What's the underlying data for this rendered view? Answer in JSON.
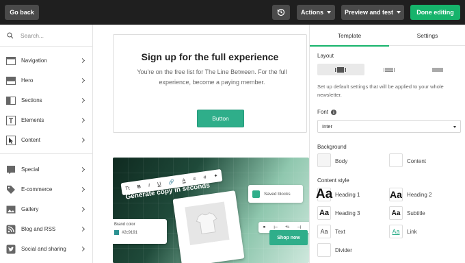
{
  "topbar": {
    "go_back": "Go back",
    "actions": "Actions",
    "preview": "Preview and test",
    "done": "Done editing",
    "history_icon": "history-icon"
  },
  "sidebar": {
    "search_placeholder": "Search...",
    "items": [
      {
        "label": "Navigation",
        "icon": "navigation-icon"
      },
      {
        "label": "Hero",
        "icon": "hero-icon"
      },
      {
        "label": "Sections",
        "icon": "sections-icon"
      },
      {
        "label": "Elements",
        "icon": "elements-icon"
      },
      {
        "label": "Content",
        "icon": "cursor-icon"
      },
      {
        "label": "Special",
        "icon": "special-icon"
      },
      {
        "label": "E-commerce",
        "icon": "tag-icon"
      },
      {
        "label": "Gallery",
        "icon": "image-icon"
      },
      {
        "label": "Blog and RSS",
        "icon": "rss-icon"
      },
      {
        "label": "Social and sharing",
        "icon": "twitter-icon"
      }
    ]
  },
  "canvas": {
    "card_title": "Sign up for the full experience",
    "card_body": "You're on the free list for The Line Between. For the full experience, become a paying member.",
    "card_button": "Button",
    "promo": {
      "toolbar": [
        "Tt",
        "B",
        "I",
        "U",
        "🔗",
        "A",
        "≡",
        "#",
        "✦"
      ],
      "headline": "Generate copy in seconds",
      "saved_blocks": "Saved blocks",
      "brand_color_label": "Brand color",
      "brand_color_value": "#2c9191",
      "shop_now": "Shop now"
    }
  },
  "panel": {
    "tabs": [
      "Template",
      "Settings"
    ],
    "layout_label": "Layout",
    "layout_desc": "Set up default settings that will be applied to your whole newsletter.",
    "font_label": "Font",
    "font_value": "Inter",
    "background_label": "Background",
    "body_label": "Body",
    "content_label": "Content",
    "content_style_label": "Content style",
    "styles": [
      {
        "sample": "Aa",
        "label": "Heading 1"
      },
      {
        "sample": "Aa",
        "label": "Heading 2"
      },
      {
        "sample": "Aa",
        "label": "Heading 3"
      },
      {
        "sample": "Aa",
        "label": "Subtitle"
      },
      {
        "sample": "Aa",
        "label": "Text"
      },
      {
        "sample": "Aa",
        "label": "Link"
      },
      {
        "sample": "",
        "label": "Divider"
      }
    ]
  },
  "colors": {
    "accent_green": "#16b36b",
    "button_teal": "#2fae8a",
    "topbar": "#1f1f1f"
  }
}
